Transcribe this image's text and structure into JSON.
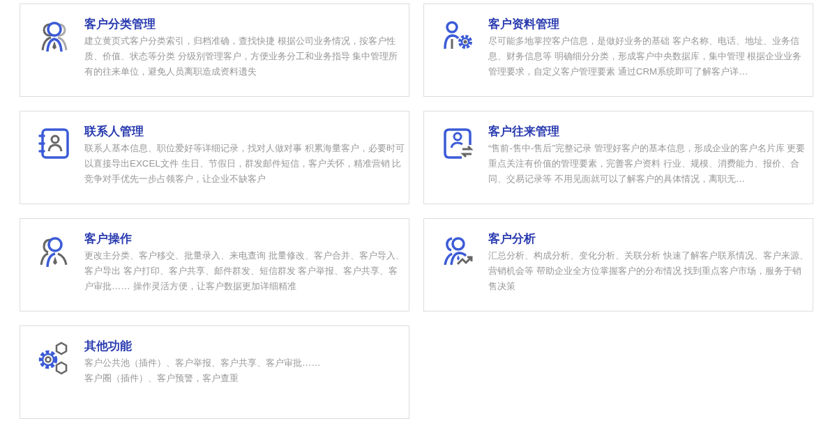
{
  "features": [
    {
      "title": "客户分类管理",
      "description": [
        "建立黄页式客户分类索引，归档准确，查找快捷 根据公司业务情况，按客户性质、价值、状态等分类 分级别管理客户，方便业务分工和业务指导 集中管理所有的往来单位，避免人员离职造成资料遗失"
      ]
    },
    {
      "title": "客户资料管理",
      "description": [
        "尽可能多地掌控客户信息，是做好业务的基础 客户名称、电话、地址、业务信息、财务信息等 明确细分分类，形成客户中央数据库，集中管理 根据企业业务管理要求，自定义客户管理要素 通过CRM系统即可了解客户详…"
      ]
    },
    {
      "title": "联系人管理",
      "description": [
        "联系人基本信息、职位爱好等详细记录，找对人做对事 积累海量客户，必要时可以直接导出EXCEL文件 生日、节假日，群发邮件短信，客户关怀，精准营销 比竞争对手优先一步占领客户，让企业不缺客户"
      ]
    },
    {
      "title": "客户往来管理",
      "description": [
        "“售前-售中-售后”完整记录 管理好客户的基本信息，形成企业的客户名片库 更要重点关注有价值的管理要素，完善客户资料 行业、规模、消费能力、报价、合同、交易记录等 不用见面就可以了解客户的具体情况，离职无…"
      ]
    },
    {
      "title": "客户操作",
      "description": [
        "更改主分类、客户移交、批量录入、来电查询 批量修改、客户合并、客户导入、客户导出 客户打印、客户共享、邮件群发、短信群发 客户举报、客户共享、客户审批…… 操作灵活方便，让客户数据更加详细精准"
      ]
    },
    {
      "title": "客户分析",
      "description": [
        "汇总分析、构成分析、变化分析、关联分析 快速了解客户联系情况、客户来源、营销机会等 帮助企业全方位掌握客户的分布情况 找到重点客户市场，服务于销售决策"
      ]
    },
    {
      "title": "其他功能",
      "description": [
        "客户公共池（插件）、客户举报、客户共享、客户审批……",
        "客户圈（插件）、客户预警，客户查重"
      ]
    }
  ]
}
